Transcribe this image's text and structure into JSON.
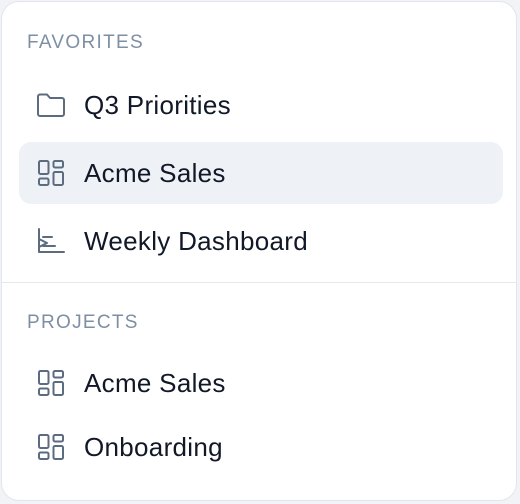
{
  "favorites": {
    "heading": "FAVORITES",
    "items": [
      {
        "label": "Q3 Priorities",
        "icon": "folder-icon",
        "active": false
      },
      {
        "label": "Acme Sales",
        "icon": "grid-layout-icon",
        "active": true
      },
      {
        "label": "Weekly Dashboard",
        "icon": "chart-icon",
        "active": false
      }
    ]
  },
  "projects": {
    "heading": "PROJECTS",
    "items": [
      {
        "label": "Acme Sales",
        "icon": "grid-layout-icon",
        "active": false
      },
      {
        "label": "Onboarding",
        "icon": "grid-layout-icon",
        "active": false
      }
    ]
  },
  "colors": {
    "active_background": "#eef2f7",
    "icon_stroke": "#5b6b80",
    "section_heading": "#7e8fa3",
    "text": "#111827"
  }
}
